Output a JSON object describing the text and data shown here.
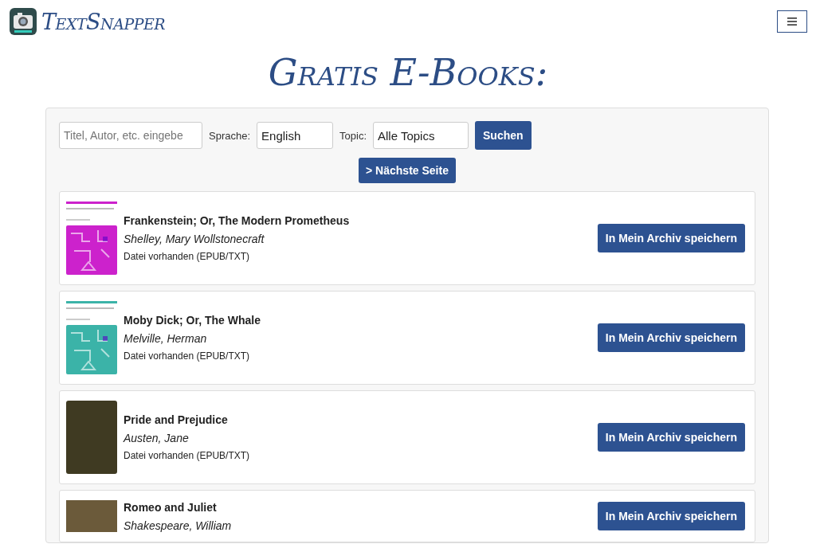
{
  "header": {
    "logo_text": "TextSnapper"
  },
  "page_title": "Gratis E-Books:",
  "search": {
    "placeholder": "Titel, Autor, etc. eingebe",
    "language_label": "Sprache:",
    "language_value": "English",
    "topic_label": "Topic:",
    "topic_value": "Alle Topics",
    "search_button": "Suchen",
    "next_button": "> Nächste Seite"
  },
  "books": [
    {
      "title": "Frankenstein; Or, The Modern Prometheus",
      "author": "Shelley, Mary Wollstonecraft",
      "file_status": "Datei vorhanden (EPUB/TXT)",
      "kind": "pattern",
      "color": "#cc22cc",
      "button": "In Mein Archiv speichern"
    },
    {
      "title": "Moby Dick; Or, The Whale",
      "author": "Melville, Herman",
      "file_status": "Datei vorhanden (EPUB/TXT)",
      "kind": "pattern",
      "color": "#3bb3a8",
      "button": "In Mein Archiv speichern"
    },
    {
      "title": "Pride and Prejudice",
      "author": "Austen, Jane",
      "file_status": "Datei vorhanden (EPUB/TXT)",
      "kind": "photo",
      "color": "#3f3a22",
      "button": "In Mein Archiv speichern"
    },
    {
      "title": "Romeo and Juliet",
      "author": "Shakespeare, William",
      "kind": "banner",
      "color": "#6b5a3a",
      "button": "In Mein Archiv speichern"
    }
  ]
}
